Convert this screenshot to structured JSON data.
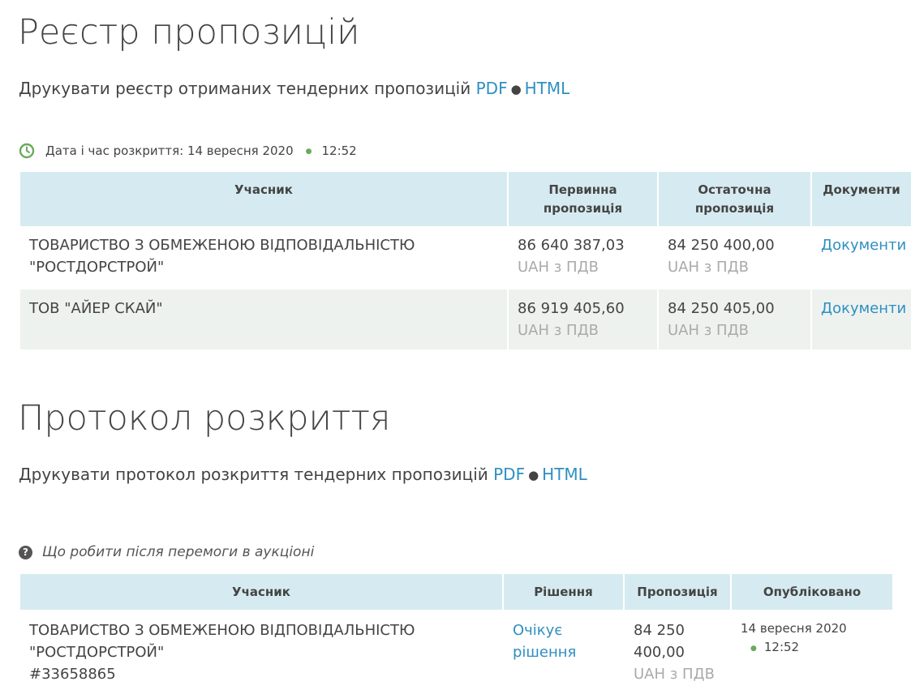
{
  "registry": {
    "title": "Реєстр пропозицій",
    "print_text": "Друкувати реєстр отриманих тендерних пропозицій",
    "pdf_label": "PDF",
    "html_label": "HTML",
    "opening_label": "Дата і час розкриття: 14 вересня 2020",
    "opening_time": "12:52",
    "columns": [
      "Учасник",
      "Первинна пропозиція",
      "Остаточна пропозиція",
      "Документи"
    ],
    "rows": [
      {
        "participant": "ТОВАРИСТВО З ОБМЕЖЕНОЮ ВІДПОВІДАЛЬНІСТЮ \"РОСТДОРСТРОЙ\"",
        "initial": "86 640 387,03",
        "initial_currency": "UAH з ПДВ",
        "final": "84 250 400,00",
        "final_currency": "UAH з ПДВ",
        "documents": "Документи"
      },
      {
        "participant": "ТОВ \"АЙЕР СКАЙ\"",
        "initial": "86 919 405,60",
        "initial_currency": "UAH з ПДВ",
        "final": "84 250 405,00",
        "final_currency": "UAH з ПДВ",
        "documents": "Документи"
      }
    ]
  },
  "protocol": {
    "title": "Протокол розкриття",
    "print_text": "Друкувати протокол розкриття тендерних пропозицій",
    "pdf_label": "PDF",
    "html_label": "HTML",
    "help_text": "Що робити після перемоги в аукціоні",
    "columns": [
      "Учасник",
      "Рішення",
      "Пропозиція",
      "Опубліковано"
    ],
    "rows": [
      {
        "participant": "ТОВАРИСТВО З ОБМЕЖЕНОЮ ВІДПОВІДАЛЬНІСТЮ \"РОСТДОРСТРОЙ\"",
        "code": "#33658865",
        "decision": "Очікує рішення",
        "offer": "84 250 400,00",
        "offer_currency": "UAH з ПДВ",
        "published_date": "14 вересня 2020",
        "published_time": "12:52"
      }
    ]
  },
  "colors": {
    "link": "#2f8fc1",
    "header_bg": "#d6ebf1",
    "alt_row_bg": "#eef2ef",
    "clock_green": "#6aaa5e"
  },
  "icons": {
    "clock": "clock-icon",
    "help": "question-circle-icon"
  }
}
